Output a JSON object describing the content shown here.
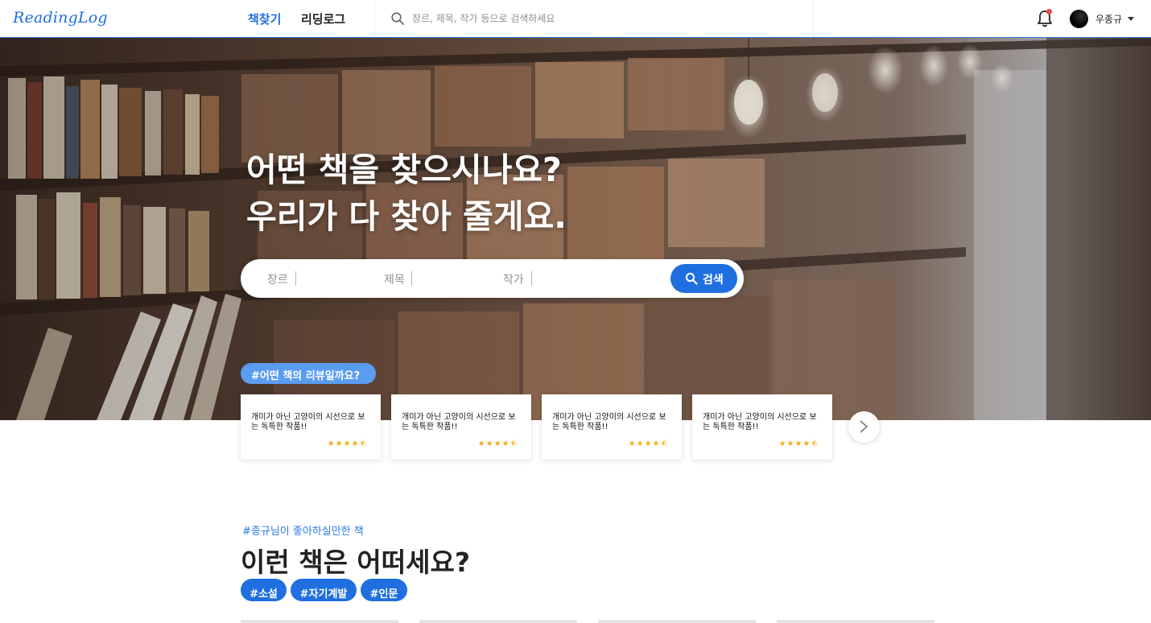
{
  "app": {
    "logo": "ReadingLog"
  },
  "nav": {
    "tabs": [
      {
        "label": "책찾기",
        "active": true
      },
      {
        "label": "리딩로그",
        "active": false
      }
    ]
  },
  "top_search": {
    "placeholder": "장르, 제목, 작가 등으로 검색하세요",
    "icon": "search-icon"
  },
  "user": {
    "name": "우종규",
    "has_notification": true
  },
  "hero": {
    "title_line1": "어떤 책을 찾으시나요?",
    "title_line2": "우리가 다 찾아 줄게요.",
    "search": {
      "genre_label": "장르",
      "title_label": "제목",
      "author_label": "작가",
      "button_label": "검색"
    },
    "review_tag": "#어떤 책의 리뷰일까요?"
  },
  "reviews": [
    {
      "text": "개미가 아닌 고양이의 시선으로 보는 독특한 작품!!",
      "rating": 4.5
    },
    {
      "text": "개미가 아닌 고양이의 시선으로 보는 독특한 작품!!",
      "rating": 4.5
    },
    {
      "text": "개미가 아닌 고양이의 시선으로 보는 독특한 작품!!",
      "rating": 4.5
    },
    {
      "text": "개미가 아닌 고양이의 시선으로 보는 독특한 작품!!",
      "rating": 4.5
    }
  ],
  "recommend": {
    "tag": "#종규님이 좋아하실만한 책",
    "title": "이런 책은 어떠세요?",
    "chips": [
      "#소설",
      "#자기계발",
      "#인문"
    ]
  },
  "colors": {
    "accent": "#1f6fe0",
    "star": "#f2b01e",
    "tag_pill": "#5a9cf0"
  }
}
